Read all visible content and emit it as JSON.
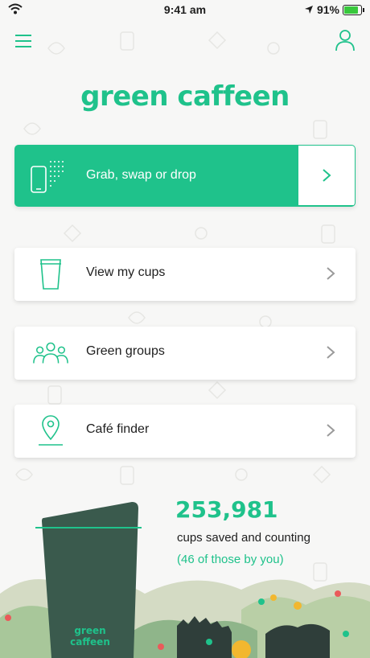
{
  "status_bar": {
    "time": "9:41 am",
    "battery_percent": "91%"
  },
  "app": {
    "logo_text": "green caffeen"
  },
  "primary_action": {
    "label": "Grab, swap or drop"
  },
  "menu_items": [
    {
      "label": "View my cups",
      "icon": "cup-icon"
    },
    {
      "label": "Green groups",
      "icon": "group-icon"
    },
    {
      "label": "Café finder",
      "icon": "location-pin-icon"
    }
  ],
  "stats": {
    "cups_saved": "253,981",
    "cups_saved_label": "cups saved and counting",
    "user_share": "(46 of those by you)"
  },
  "illustration": {
    "cup_brand_line1": "green",
    "cup_brand_line2": "caffeen"
  },
  "colors": {
    "brand_green": "#1fc28b",
    "cup_dark_green": "#3a5a4d",
    "text": "#1e1e1e"
  }
}
